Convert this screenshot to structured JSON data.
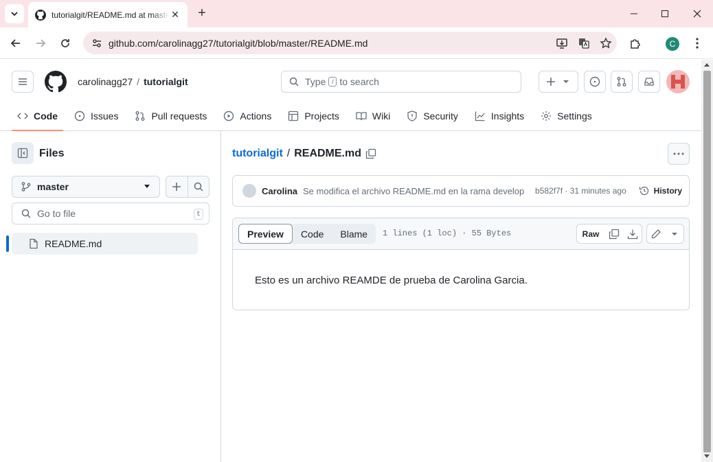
{
  "browser": {
    "tab_title": "tutorialgit/README.md at master",
    "url": "github.com/carolinagg27/tutorialgit/blob/master/README.md",
    "profile_initial": "C"
  },
  "header": {
    "owner": "carolinagg27",
    "separator": "/",
    "repo": "tutorialgit",
    "search_before": "Type",
    "search_key": "/",
    "search_after": "to search"
  },
  "repo_nav": [
    {
      "label": "Code"
    },
    {
      "label": "Issues"
    },
    {
      "label": "Pull requests"
    },
    {
      "label": "Actions"
    },
    {
      "label": "Projects"
    },
    {
      "label": "Wiki"
    },
    {
      "label": "Security"
    },
    {
      "label": "Insights"
    },
    {
      "label": "Settings"
    }
  ],
  "sidebar": {
    "title": "Files",
    "branch": "master",
    "goto_placeholder": "Go to file",
    "goto_key": "t",
    "files": [
      {
        "name": "README.md"
      }
    ]
  },
  "file": {
    "repo": "tutorialgit",
    "separator": "/",
    "name": "README.md",
    "commit": {
      "author": "Carolina",
      "message": "Se modifica el archivo README.md en la rama develop",
      "sha_time": "b582f7f · 31 minutes ago",
      "history": "History"
    },
    "tabs": [
      "Preview",
      "Code",
      "Blame"
    ],
    "meta": "1 lines (1 loc) · 55 Bytes",
    "raw": "Raw",
    "content": "Esto es un archivo REAMDE de prueba de Carolina Garcia."
  },
  "colors": {
    "link": "#0969da",
    "active_underline": "#fd8c73",
    "tabstrip": "#fbe4e8"
  }
}
